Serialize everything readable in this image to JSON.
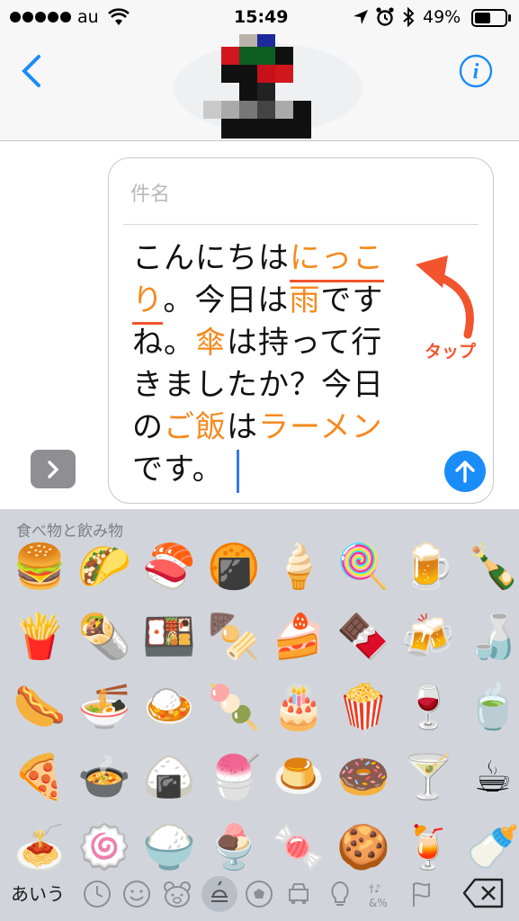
{
  "status": {
    "carrier": "au",
    "time": "15:49",
    "battery": "49%"
  },
  "compose": {
    "subject_placeholder": "件名",
    "message_segments": [
      {
        "text": "こんにちは",
        "style": "plain"
      },
      {
        "text": "にっこ",
        "style": "orange-underline"
      },
      {
        "text": "\n",
        "style": "plain"
      },
      {
        "text": "り",
        "style": "orange-underline"
      },
      {
        "text": "。今日は",
        "style": "plain"
      },
      {
        "text": "雨",
        "style": "orange"
      },
      {
        "text": "です\nね。",
        "style": "plain"
      },
      {
        "text": "傘",
        "style": "orange"
      },
      {
        "text": "は持って行\nきましたか？今日\nの",
        "style": "plain"
      },
      {
        "text": "ご飯",
        "style": "orange"
      },
      {
        "text": "は",
        "style": "plain"
      },
      {
        "text": "ラーメン",
        "style": "orange"
      },
      {
        "text": "\nです。",
        "style": "plain"
      }
    ]
  },
  "annotation": {
    "tap_label": "タップ",
    "color": "#f2542d"
  },
  "keyboard": {
    "category_title": "食べ物と飲み物",
    "language_key": "あいう",
    "emoji_rows": [
      [
        "🍔",
        "🌮",
        "🍣",
        "🍘",
        "🍦",
        "🍭",
        "🍺",
        "🍾"
      ],
      [
        "🍟",
        "🌯",
        "🍱",
        "🍢",
        "🍰",
        "🍫",
        "🍻",
        "🍶"
      ],
      [
        "🌭",
        "🍜",
        "🍛",
        "🍡",
        "🎂",
        "🍿",
        "🍷",
        "🍵"
      ],
      [
        "🍕",
        "🍲",
        "🍙",
        "🍧",
        "🍮",
        "🍩",
        "🍸",
        "☕"
      ],
      [
        "🍝",
        "🍥",
        "🍚",
        "🍨",
        "🍬",
        "🍪",
        "🍹",
        "🍼"
      ]
    ],
    "categories": [
      "clock-icon",
      "smiley-icon",
      "bear-icon",
      "food-icon",
      "ball-icon",
      "car-icon",
      "bulb-icon",
      "symbols-icon",
      "flag-icon"
    ],
    "selected_category": "food-icon"
  },
  "colors": {
    "accent_blue": "#1a8cf7",
    "highlight_orange": "#f58a1e",
    "underline_red": "#f2542d"
  }
}
